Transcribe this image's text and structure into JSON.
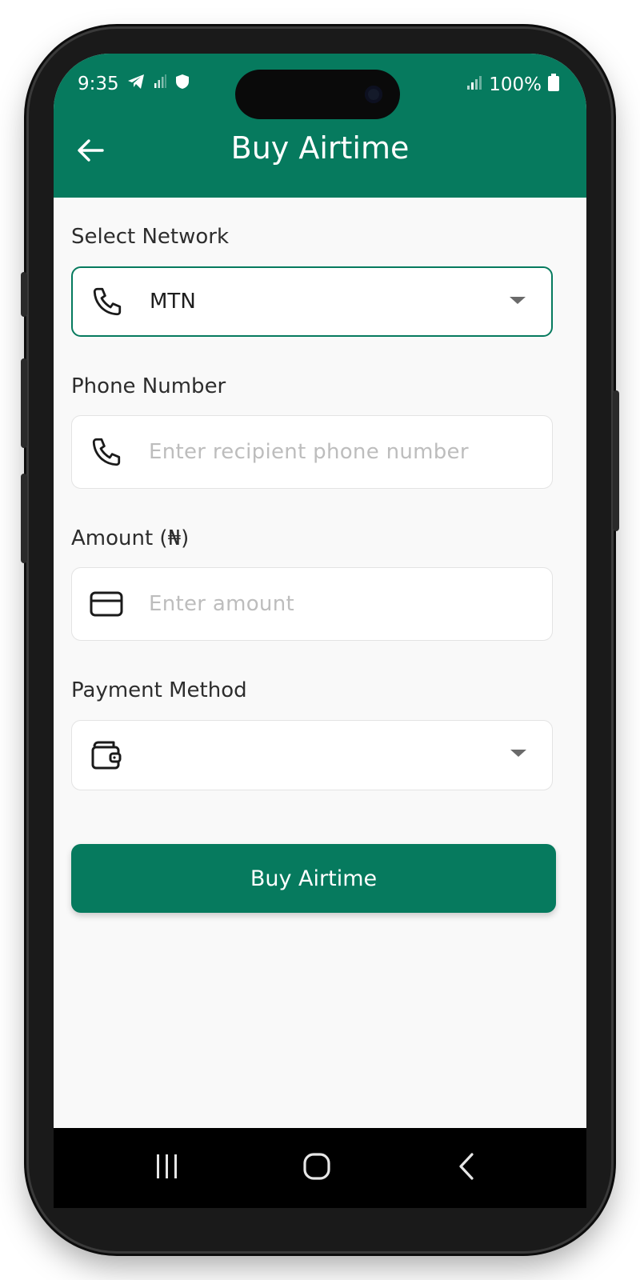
{
  "status_bar": {
    "time": "9:35",
    "battery": "100%"
  },
  "header": {
    "title": "Buy Airtime"
  },
  "form": {
    "network": {
      "label": "Select Network",
      "value": "MTN"
    },
    "phone": {
      "label": "Phone Number",
      "placeholder": "Enter recipient phone number"
    },
    "amount": {
      "label": "Amount (₦)",
      "placeholder": "Enter amount"
    },
    "payment": {
      "label": "Payment Method",
      "value": ""
    },
    "submit_label": "Buy Airtime"
  },
  "theme": {
    "primary": "#067a5e"
  },
  "icons": [
    "back-arrow-icon",
    "phone-icon",
    "card-icon",
    "wallet-icon",
    "caret-down-icon",
    "recents-icon",
    "home-icon",
    "nav-back-icon"
  ]
}
